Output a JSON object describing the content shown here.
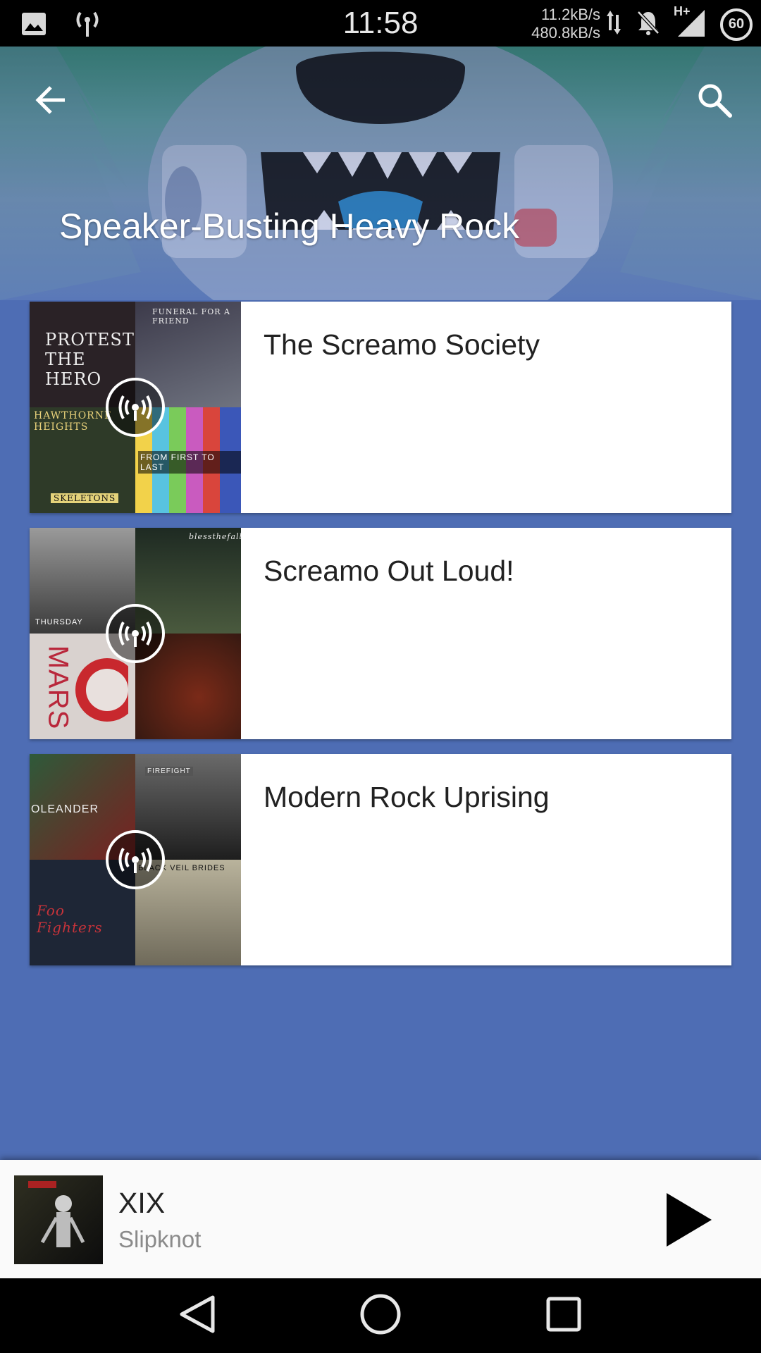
{
  "status_bar": {
    "time": "11:58",
    "speed_up": "11.2kB/s",
    "speed_down": "480.8kB/s",
    "network_type": "H+",
    "battery_level": "60",
    "icons": [
      "image-icon",
      "radio-signal-icon",
      "data-arrows-icon",
      "notifications-off-icon",
      "signal-icon"
    ]
  },
  "header": {
    "title": "Speaker-Busting Heavy Rock",
    "back_icon": "arrow-back-icon",
    "search_icon": "search-icon"
  },
  "stations": [
    {
      "name": "The Screamo Society",
      "art_text": [
        "PROTEST THE HERO",
        "FUNERAL FOR A FRIEND",
        "HAWTHORNE HEIGHTS",
        "SKELETONS",
        "FROM FIRST TO LAST"
      ],
      "badge_icon": "radio-station-icon"
    },
    {
      "name": "Screamo Out Loud!",
      "art_text": [
        "THURSDAY",
        "blessthefall",
        "MARS"
      ],
      "badge_icon": "radio-station-icon"
    },
    {
      "name": "Modern Rock Uprising",
      "art_text": [
        "OLEANDER",
        "FIREFIGHT",
        "Foo Fighters",
        "BLACK VEIL BRIDES"
      ],
      "badge_icon": "radio-station-icon"
    }
  ],
  "now_playing": {
    "title": "XIX",
    "artist": "Slipknot",
    "play_icon": "play-icon"
  },
  "nav_bar": {
    "icons": [
      "back-triangle-icon",
      "home-circle-icon",
      "recents-square-icon"
    ]
  },
  "colors": {
    "page_background": "#4e6db4",
    "card_background": "#ffffff",
    "now_playing_background": "#fafafa"
  }
}
